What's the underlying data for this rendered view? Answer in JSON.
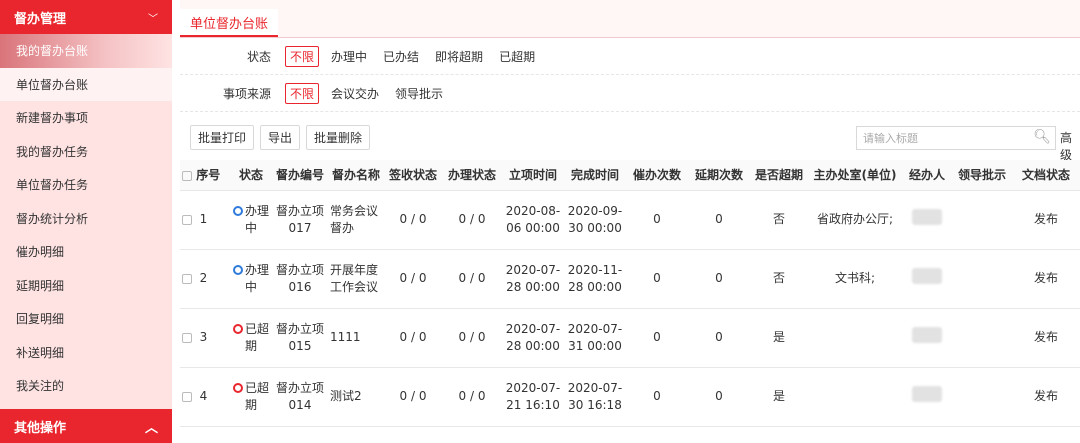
{
  "sidebar": {
    "header": "督办管理",
    "items": [
      "我的督办台账",
      "单位督办台账",
      "新建督办事项",
      "我的督办任务",
      "单位督办任务",
      "督办统计分析",
      "催办明细",
      "延期明细",
      "回复明细",
      "补送明细",
      "我关注的"
    ],
    "footer": "其他操作"
  },
  "tab": {
    "label": "单位督办台账"
  },
  "filters": {
    "status_label": "状态",
    "status_options": [
      "不限",
      "办理中",
      "已办结",
      "即将超期",
      "已超期"
    ],
    "source_label": "事项来源",
    "source_options": [
      "不限",
      "会议交办",
      "领导批示"
    ]
  },
  "toolbar": {
    "batch_print": "批量打印",
    "export": "导出",
    "batch_delete": "批量删除",
    "search_placeholder": "请输入标题",
    "advanced": "高级"
  },
  "table": {
    "headers": [
      "序号",
      "状态",
      "督办编号",
      "督办名称",
      "签收状态",
      "办理状态",
      "立项时间",
      "完成时间",
      "催办次数",
      "延期次数",
      "是否超期",
      "主办处室(单位)",
      "经办人",
      "领导批示",
      "文档状态"
    ],
    "rows": [
      {
        "index": "1",
        "status": "办理中",
        "code": "督办立项017",
        "name": "常务会议督办",
        "sign": "0 / 0",
        "handle": "0 / 0",
        "start": "2020-08-06 00:00",
        "end": "2020-09-30 00:00",
        "urge": "0",
        "delay": "0",
        "overdue": "否",
        "dept": "省政府办公厅;",
        "doc": "发布"
      },
      {
        "index": "2",
        "status": "办理中",
        "code": "督办立项016",
        "name": "开展年度工作会议",
        "sign": "0 / 0",
        "handle": "0 / 0",
        "start": "2020-07-28 00:00",
        "end": "2020-11-28 00:00",
        "urge": "0",
        "delay": "0",
        "overdue": "否",
        "dept": "文书科;",
        "doc": "发布"
      },
      {
        "index": "3",
        "status": "已超期",
        "code": "督办立项015",
        "name": "1111",
        "sign": "0 / 0",
        "handle": "0 / 0",
        "start": "2020-07-28 00:00",
        "end": "2020-07-31 00:00",
        "urge": "0",
        "delay": "0",
        "overdue": "是",
        "dept": "",
        "doc": "发布"
      },
      {
        "index": "4",
        "status": "已超期",
        "code": "督办立项014",
        "name": "测试2",
        "sign": "0 / 0",
        "handle": "0 / 0",
        "start": "2020-07-21 16:10",
        "end": "2020-07-30 16:18",
        "urge": "0",
        "delay": "0",
        "overdue": "是",
        "dept": "",
        "doc": "发布"
      }
    ]
  },
  "colors": {
    "brand": "#e9262d",
    "sidebar_bg": "#ffe3e3",
    "in_progress": "#2f7bdc",
    "overdue": "#e9262d"
  }
}
